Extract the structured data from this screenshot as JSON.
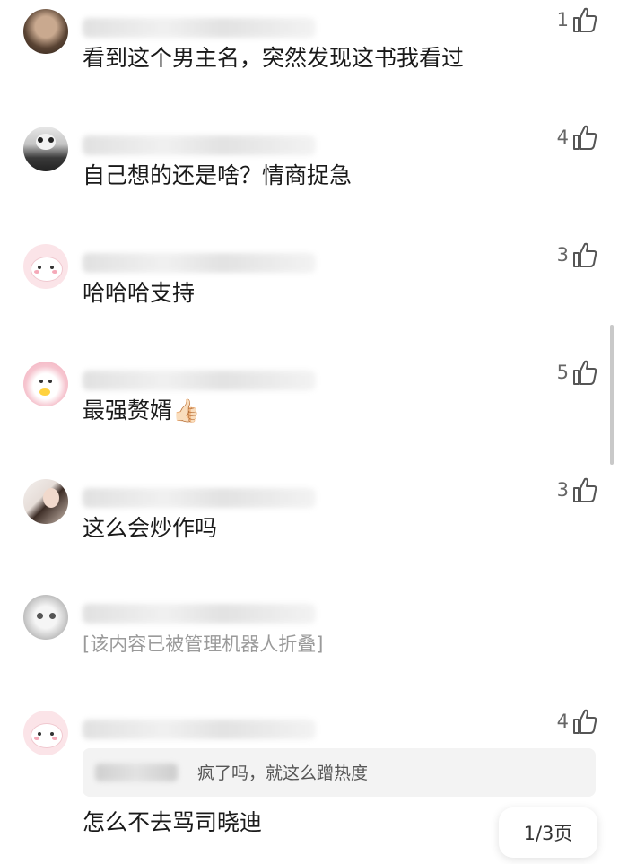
{
  "comments": [
    {
      "likes": "1",
      "text": "看到这个男主名，突然发现这书我看过"
    },
    {
      "likes": "4",
      "text": "自己想的还是啥？情商捉急"
    },
    {
      "likes": "3",
      "text": "哈哈哈支持"
    },
    {
      "likes": "5",
      "text": "最强赘婿👍🏻"
    },
    {
      "likes": "3",
      "text": "这么会炒作吗"
    },
    {
      "text": "[该内容已被管理机器人折叠]"
    },
    {
      "likes": "4",
      "quote": "疯了吗，就这么蹭热度",
      "text": "怎么不去骂司晓迪"
    }
  ],
  "pager": {
    "label": "1/3页"
  }
}
